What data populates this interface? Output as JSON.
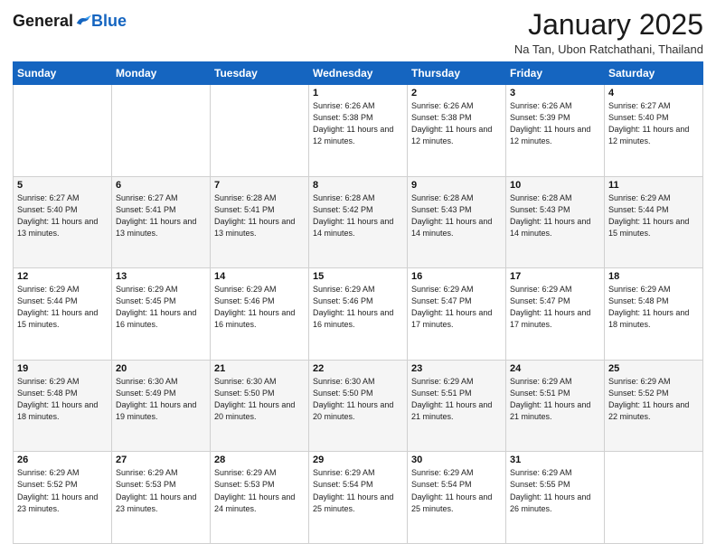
{
  "header": {
    "logo_general": "General",
    "logo_blue": "Blue",
    "title": "January 2025",
    "subtitle": "Na Tan, Ubon Ratchathani, Thailand"
  },
  "days_of_week": [
    "Sunday",
    "Monday",
    "Tuesday",
    "Wednesday",
    "Thursday",
    "Friday",
    "Saturday"
  ],
  "weeks": [
    [
      {
        "day": "",
        "info": ""
      },
      {
        "day": "",
        "info": ""
      },
      {
        "day": "",
        "info": ""
      },
      {
        "day": "1",
        "info": "Sunrise: 6:26 AM\nSunset: 5:38 PM\nDaylight: 11 hours and 12 minutes."
      },
      {
        "day": "2",
        "info": "Sunrise: 6:26 AM\nSunset: 5:38 PM\nDaylight: 11 hours and 12 minutes."
      },
      {
        "day": "3",
        "info": "Sunrise: 6:26 AM\nSunset: 5:39 PM\nDaylight: 11 hours and 12 minutes."
      },
      {
        "day": "4",
        "info": "Sunrise: 6:27 AM\nSunset: 5:40 PM\nDaylight: 11 hours and 12 minutes."
      }
    ],
    [
      {
        "day": "5",
        "info": "Sunrise: 6:27 AM\nSunset: 5:40 PM\nDaylight: 11 hours and 13 minutes."
      },
      {
        "day": "6",
        "info": "Sunrise: 6:27 AM\nSunset: 5:41 PM\nDaylight: 11 hours and 13 minutes."
      },
      {
        "day": "7",
        "info": "Sunrise: 6:28 AM\nSunset: 5:41 PM\nDaylight: 11 hours and 13 minutes."
      },
      {
        "day": "8",
        "info": "Sunrise: 6:28 AM\nSunset: 5:42 PM\nDaylight: 11 hours and 14 minutes."
      },
      {
        "day": "9",
        "info": "Sunrise: 6:28 AM\nSunset: 5:43 PM\nDaylight: 11 hours and 14 minutes."
      },
      {
        "day": "10",
        "info": "Sunrise: 6:28 AM\nSunset: 5:43 PM\nDaylight: 11 hours and 14 minutes."
      },
      {
        "day": "11",
        "info": "Sunrise: 6:29 AM\nSunset: 5:44 PM\nDaylight: 11 hours and 15 minutes."
      }
    ],
    [
      {
        "day": "12",
        "info": "Sunrise: 6:29 AM\nSunset: 5:44 PM\nDaylight: 11 hours and 15 minutes."
      },
      {
        "day": "13",
        "info": "Sunrise: 6:29 AM\nSunset: 5:45 PM\nDaylight: 11 hours and 16 minutes."
      },
      {
        "day": "14",
        "info": "Sunrise: 6:29 AM\nSunset: 5:46 PM\nDaylight: 11 hours and 16 minutes."
      },
      {
        "day": "15",
        "info": "Sunrise: 6:29 AM\nSunset: 5:46 PM\nDaylight: 11 hours and 16 minutes."
      },
      {
        "day": "16",
        "info": "Sunrise: 6:29 AM\nSunset: 5:47 PM\nDaylight: 11 hours and 17 minutes."
      },
      {
        "day": "17",
        "info": "Sunrise: 6:29 AM\nSunset: 5:47 PM\nDaylight: 11 hours and 17 minutes."
      },
      {
        "day": "18",
        "info": "Sunrise: 6:29 AM\nSunset: 5:48 PM\nDaylight: 11 hours and 18 minutes."
      }
    ],
    [
      {
        "day": "19",
        "info": "Sunrise: 6:29 AM\nSunset: 5:48 PM\nDaylight: 11 hours and 18 minutes."
      },
      {
        "day": "20",
        "info": "Sunrise: 6:30 AM\nSunset: 5:49 PM\nDaylight: 11 hours and 19 minutes."
      },
      {
        "day": "21",
        "info": "Sunrise: 6:30 AM\nSunset: 5:50 PM\nDaylight: 11 hours and 20 minutes."
      },
      {
        "day": "22",
        "info": "Sunrise: 6:30 AM\nSunset: 5:50 PM\nDaylight: 11 hours and 20 minutes."
      },
      {
        "day": "23",
        "info": "Sunrise: 6:29 AM\nSunset: 5:51 PM\nDaylight: 11 hours and 21 minutes."
      },
      {
        "day": "24",
        "info": "Sunrise: 6:29 AM\nSunset: 5:51 PM\nDaylight: 11 hours and 21 minutes."
      },
      {
        "day": "25",
        "info": "Sunrise: 6:29 AM\nSunset: 5:52 PM\nDaylight: 11 hours and 22 minutes."
      }
    ],
    [
      {
        "day": "26",
        "info": "Sunrise: 6:29 AM\nSunset: 5:52 PM\nDaylight: 11 hours and 23 minutes."
      },
      {
        "day": "27",
        "info": "Sunrise: 6:29 AM\nSunset: 5:53 PM\nDaylight: 11 hours and 23 minutes."
      },
      {
        "day": "28",
        "info": "Sunrise: 6:29 AM\nSunset: 5:53 PM\nDaylight: 11 hours and 24 minutes."
      },
      {
        "day": "29",
        "info": "Sunrise: 6:29 AM\nSunset: 5:54 PM\nDaylight: 11 hours and 25 minutes."
      },
      {
        "day": "30",
        "info": "Sunrise: 6:29 AM\nSunset: 5:54 PM\nDaylight: 11 hours and 25 minutes."
      },
      {
        "day": "31",
        "info": "Sunrise: 6:29 AM\nSunset: 5:55 PM\nDaylight: 11 hours and 26 minutes."
      },
      {
        "day": "",
        "info": ""
      }
    ]
  ]
}
